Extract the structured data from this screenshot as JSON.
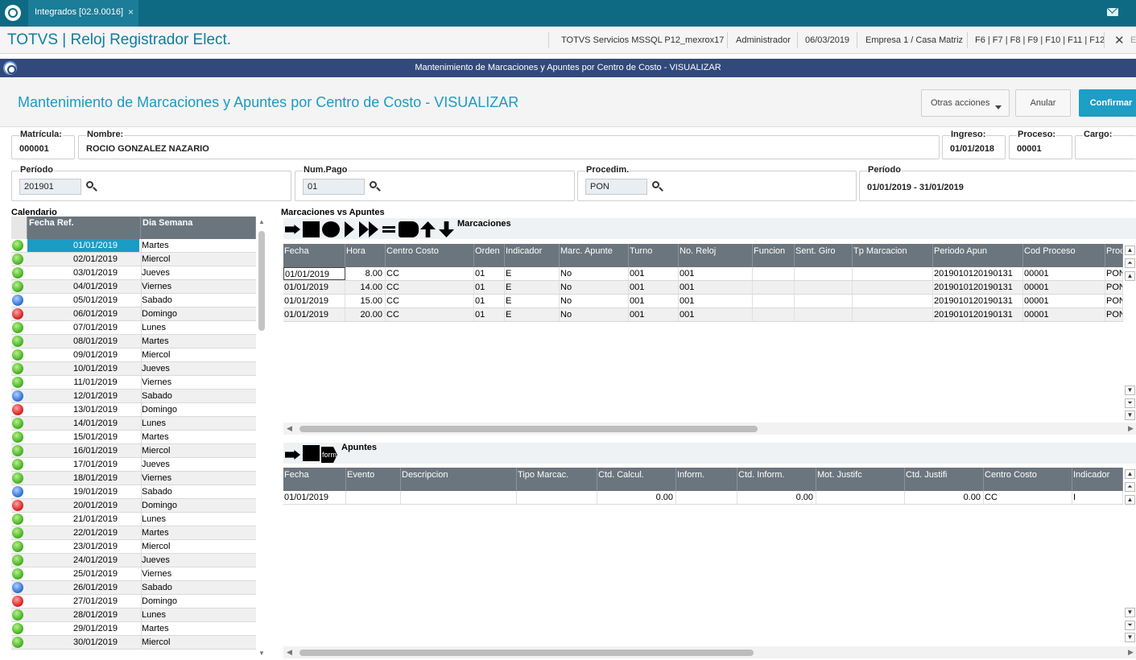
{
  "topbar": {
    "tab_label": "Integrados [02.9.0016]",
    "tab_close": "×"
  },
  "app": {
    "title": "TOTVS | Reloj Registrador Elect.",
    "server": "TOTVS Servicios MSSQL P12_mexrox17",
    "user": "Administrador",
    "date": "06/03/2019",
    "company": "Empresa 1 / Casa Matriz",
    "shortcuts": "F6 | F7 | F8 | F9 | F10 | F11 | F12",
    "close": "✕",
    "extra": "E"
  },
  "dialog": {
    "bar_title": "Mantenimiento de Marcaciones y Apuntes por Centro de Costo - VISUALIZAR",
    "title": "Mantenimiento de Marcaciones y Apuntes por Centro de Costo - VISUALIZAR",
    "btn_otras": "Otras acciones",
    "btn_anular": "Anular",
    "btn_confirmar": "Confirmar"
  },
  "fields": {
    "matricula": {
      "label": "Matrícula:",
      "value": "000001"
    },
    "nombre": {
      "label": "Nombre:",
      "value": "ROCIO  GONZALEZ NAZARIO"
    },
    "ingreso": {
      "label": "Ingreso:",
      "value": "01/01/2018"
    },
    "proceso": {
      "label": "Proceso:",
      "value": "00001"
    },
    "cargo": {
      "label": "Cargo:",
      "value": ""
    },
    "periodo": {
      "label": "Período",
      "value": "201901"
    },
    "numpago": {
      "label": "Num.Pago",
      "value": "01"
    },
    "procedim": {
      "label": "Procedim.",
      "value": "PON"
    },
    "periodo2": {
      "label": "Período",
      "value": "01/01/2019 - 31/01/2019"
    }
  },
  "calendar": {
    "label": "Calendario",
    "headers": [
      "Fecha Ref.",
      "Dia Semana"
    ],
    "rows": [
      {
        "date": "01/01/2019",
        "day": "Martes",
        "status": "green"
      },
      {
        "date": "02/01/2019",
        "day": "Miercol",
        "status": "green"
      },
      {
        "date": "03/01/2019",
        "day": "Jueves",
        "status": "green"
      },
      {
        "date": "04/01/2019",
        "day": "Viernes",
        "status": "green"
      },
      {
        "date": "05/01/2019",
        "day": "Sabado",
        "status": "blue"
      },
      {
        "date": "06/01/2019",
        "day": "Domingo",
        "status": "red"
      },
      {
        "date": "07/01/2019",
        "day": "Lunes",
        "status": "green"
      },
      {
        "date": "08/01/2019",
        "day": "Martes",
        "status": "green"
      },
      {
        "date": "09/01/2019",
        "day": "Miercol",
        "status": "green"
      },
      {
        "date": "10/01/2019",
        "day": "Jueves",
        "status": "green"
      },
      {
        "date": "11/01/2019",
        "day": "Viernes",
        "status": "green"
      },
      {
        "date": "12/01/2019",
        "day": "Sabado",
        "status": "blue"
      },
      {
        "date": "13/01/2019",
        "day": "Domingo",
        "status": "red"
      },
      {
        "date": "14/01/2019",
        "day": "Lunes",
        "status": "green"
      },
      {
        "date": "15/01/2019",
        "day": "Martes",
        "status": "green"
      },
      {
        "date": "16/01/2019",
        "day": "Miercol",
        "status": "green"
      },
      {
        "date": "17/01/2019",
        "day": "Jueves",
        "status": "green"
      },
      {
        "date": "18/01/2019",
        "day": "Viernes",
        "status": "green"
      },
      {
        "date": "19/01/2019",
        "day": "Sabado",
        "status": "blue"
      },
      {
        "date": "20/01/2019",
        "day": "Domingo",
        "status": "red"
      },
      {
        "date": "21/01/2019",
        "day": "Lunes",
        "status": "green"
      },
      {
        "date": "22/01/2019",
        "day": "Martes",
        "status": "green"
      },
      {
        "date": "23/01/2019",
        "day": "Miercol",
        "status": "green"
      },
      {
        "date": "24/01/2019",
        "day": "Jueves",
        "status": "green"
      },
      {
        "date": "25/01/2019",
        "day": "Viernes",
        "status": "green"
      },
      {
        "date": "26/01/2019",
        "day": "Sabado",
        "status": "blue"
      },
      {
        "date": "27/01/2019",
        "day": "Domingo",
        "status": "red"
      },
      {
        "date": "28/01/2019",
        "day": "Lunes",
        "status": "green"
      },
      {
        "date": "29/01/2019",
        "day": "Martes",
        "status": "green"
      },
      {
        "date": "30/01/2019",
        "day": "Miercol",
        "status": "green"
      }
    ]
  },
  "marcaciones": {
    "section_label": "Marcaciones vs Apuntes",
    "toolbar_label": "Marcaciones",
    "headers": [
      "Fecha",
      "Hora",
      "Centro Costo",
      "Orden",
      "Indicador",
      "Marc. Apunte",
      "Turno",
      "No. Reloj",
      "Funcion",
      "Sent. Giro",
      "Tp Marcacion",
      "Periodo Apun",
      "Cod Proceso",
      "Proc"
    ],
    "rows": [
      [
        "01/01/2019",
        "8.00",
        "CC",
        "01",
        "E",
        "No",
        "001",
        "001",
        "",
        "",
        "",
        "2019010120190131",
        "00001",
        "PON"
      ],
      [
        "01/01/2019",
        "14.00",
        "CC",
        "01",
        "E",
        "No",
        "001",
        "001",
        "",
        "",
        "",
        "2019010120190131",
        "00001",
        "PON"
      ],
      [
        "01/01/2019",
        "15.00",
        "CC",
        "01",
        "E",
        "No",
        "001",
        "001",
        "",
        "",
        "",
        "2019010120190131",
        "00001",
        "PON"
      ],
      [
        "01/01/2019",
        "20.00",
        "CC",
        "01",
        "E",
        "No",
        "001",
        "001",
        "",
        "",
        "",
        "2019010120190131",
        "00001",
        "PON"
      ]
    ]
  },
  "apuntes": {
    "toolbar_label": "Apuntes",
    "toolbar_icon_text": "form",
    "headers": [
      "Fecha",
      "Evento",
      "Descripcion",
      "Tipo Marcac.",
      "Ctd. Calcul.",
      "Inform.",
      "Ctd. Inform.",
      "Mot. Justifc",
      "Ctd. Justifi",
      "Centro Costo",
      "Indicador"
    ],
    "rows": [
      [
        "01/01/2019",
        "",
        "",
        "",
        "0.00",
        "",
        "0.00",
        "",
        "0.00",
        "CC",
        "I"
      ]
    ]
  },
  "colors": {
    "brand": "#0e6a83",
    "accent": "#1a9cc4",
    "dialog_bar": "#32497c",
    "grid_header": "#6b757d"
  },
  "icons": [
    "totvs-logo-icon",
    "mail-icon",
    "search-icon",
    "scroll-up-icon",
    "scroll-down-icon"
  ]
}
